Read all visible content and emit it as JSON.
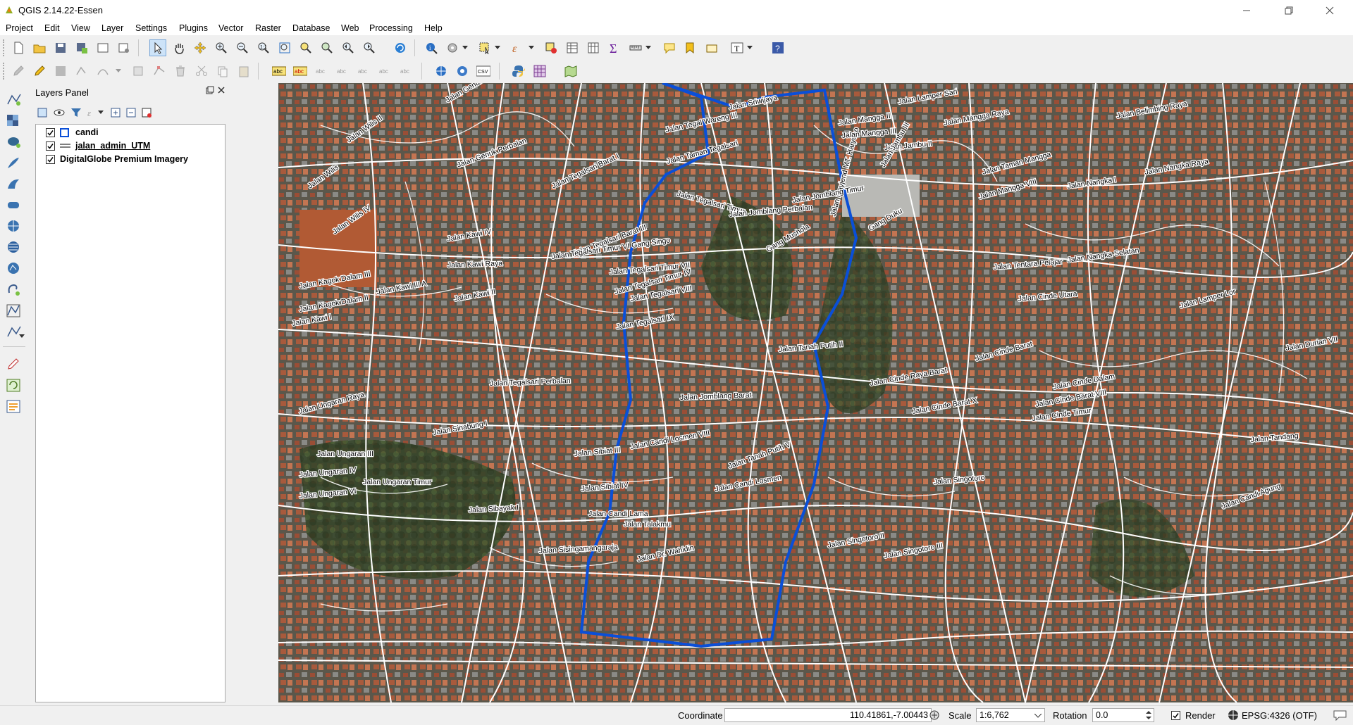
{
  "window": {
    "title": "QGIS 2.14.22-Essen"
  },
  "menu": [
    "Project",
    "Edit",
    "View",
    "Layer",
    "Settings",
    "Plugins",
    "Vector",
    "Raster",
    "Database",
    "Web",
    "Processing",
    "Help"
  ],
  "layers_panel": {
    "title": "Layers Panel",
    "layers": [
      {
        "name": "candi",
        "checked": true,
        "symbol": "polygon-outline-blue"
      },
      {
        "name": "jalan_admin_UTM",
        "checked": true,
        "symbol": "line"
      },
      {
        "name": "DigitalGlobe Premium Imagery",
        "checked": true,
        "symbol": "none"
      }
    ]
  },
  "map": {
    "street_labels": [
      "Jalan Sriwijaya",
      "Jalan Mayjend MT. Haryono",
      "Jalan Tegal Wareng III",
      "Jalan Genuk Baru",
      "Jalan Genuk Perbalan",
      "Jalan Tegalsari Barat I",
      "Jalan Taman Tegalsari",
      "Jalan Tegalsari Timur",
      "Jalan Tegalsari Barat III",
      "Jalan Tegalsari Timur IV",
      "Jalan Tegalsari Timur VI Gang Singo",
      "Jalan Tegalsari Timur VII",
      "Jalan Tegalsari VIII",
      "Jalan Tegalsari IX",
      "Jalan Tegalsari Perbalan",
      "Jalan Jomblang Barat",
      "Jalan Jomblang Perbalan",
      "Jalan Jomblang Timur",
      "Jalan Tanah Putih II",
      "Jalan Tanah Putih V",
      "Jalan Candi Losmen",
      "Jalan Candi Losmen VIII",
      "Jalan Candi Lama",
      "Jalan Sisingamangaraja",
      "Jalan Dr. Wahidin",
      "Jalan Sibiat III",
      "Jalan Sibiat IV",
      "Jalan Sibayak I",
      "Jalan Talakmu",
      "Jalan Ungaran Timur",
      "Jalan Ungaran III",
      "Jalan Ungaran IV",
      "Jalan Ungaran VI",
      "Jalan Ungaran Raya",
      "Jalan Sinabung I",
      "Jalan Kawi Raya",
      "Jalan Kawi I",
      "Jalan Kawi II",
      "Jalan Kawi III A",
      "Jalan Kawi IV",
      "Jalan Kagok Dalam III",
      "Jalan Kagok Dalam II",
      "Jalan Wilis",
      "Jalan Wilis II",
      "Jalan Wilis IV",
      "Jalan Mangga II",
      "Jalan Mangga III",
      "Jalan Mangga Raya",
      "Jalan Taman Mangga",
      "Jalan Mangga VIII",
      "Jalan Lamper Sari",
      "Jalan Jambu II",
      "Jalan Jambu III",
      "Jalan Nangka Raya",
      "Jalan Nangka Selatan",
      "Jalan Nangka I",
      "Jalan Tentara Pelajar",
      "Jalan Cinde Utara",
      "Jalan Cinde Barat",
      "Jalan Cinde Barat VIII",
      "Jalan Cinde Barat X",
      "Jalan Cinde Raya Barat",
      "Jalan Cinde Dalam",
      "Jalan Cinde Timur",
      "Jalan Singotoro",
      "Jalan Singotoro II",
      "Jalan Singotoro III",
      "Jalan Tandang",
      "Jalan Candi Agung",
      "Gang Mushola",
      "Gang Duku",
      "Jalan Belimbing Raya",
      "Jalan Durian VII",
      "Jalan Lamper Lor"
    ]
  },
  "status": {
    "coordinate_label": "Coordinate",
    "coordinate_value": "110.41861,-7.00443",
    "scale_label": "Scale",
    "scale_value": "1:6,762",
    "rotation_label": "Rotation",
    "rotation_value": "0.0",
    "render_label": "Render",
    "render_checked": true,
    "crs": "EPSG:4326 (OTF)"
  },
  "colors": {
    "accent": "#0a4fd8",
    "road": "#ffffff",
    "imagery": "#4d4a40"
  }
}
